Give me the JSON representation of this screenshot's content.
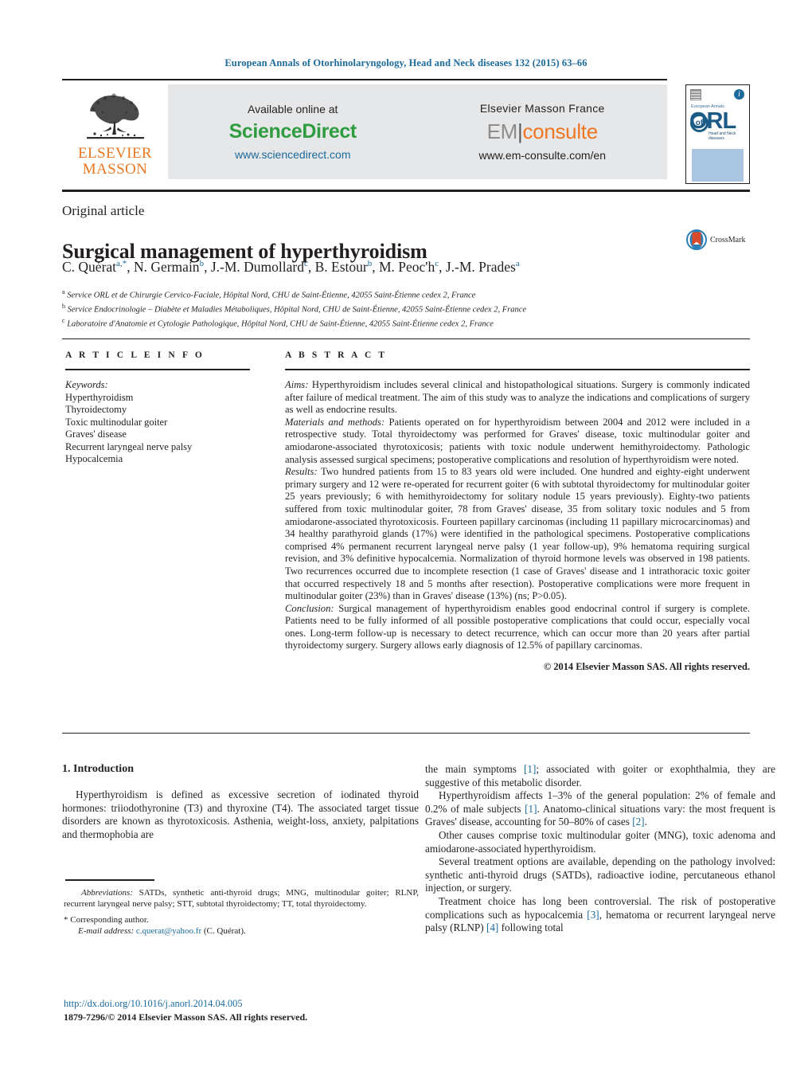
{
  "running_head": "European Annals of Otorhinolaryngology, Head and Neck diseases 132 (2015) 63–66",
  "banner": {
    "publisher_logo_text_line1": "ELSEVIER",
    "publisher_logo_text_line2": "MASSON",
    "sciencedirect": {
      "available_label": "Available online at",
      "brand": "ScienceDirect",
      "url": "www.sciencedirect.com"
    },
    "emconsulte": {
      "publisher_label": "Elsevier Masson France",
      "brand_left": "EM",
      "brand_right": "consulte",
      "url": "www.em-consulte.com/en"
    },
    "cover": {
      "journal_prefix": "European Annals",
      "of": "of",
      "title": "ORL",
      "subtitle": "Head and Neck diseases"
    }
  },
  "article": {
    "kicker": "Original article",
    "title": "Surgical management of hyperthyroidism",
    "crossmark_label": "CrossMark",
    "authors": [
      {
        "name": "C. Quérat",
        "sup": "a,*"
      },
      {
        "name": "N. Germain",
        "sup": "b"
      },
      {
        "name": "J.-M. Dumollard",
        "sup": "c"
      },
      {
        "name": "B. Estour",
        "sup": "b"
      },
      {
        "name": "M. Peoc'h",
        "sup": "c"
      },
      {
        "name": "J.-M. Prades",
        "sup": "a"
      }
    ],
    "affiliations": [
      {
        "mark": "a",
        "text": "Service ORL et de Chirurgie Cervico-Faciale, Hôpital Nord, CHU de Saint-Étienne, 42055 Saint-Étienne cedex 2, France"
      },
      {
        "mark": "b",
        "text": "Service Endocrinologie – Diabète et Maladies Métaboliques, Hôpital Nord, CHU de Saint-Étienne, 42055 Saint-Étienne cedex 2, France"
      },
      {
        "mark": "c",
        "text": "Laboratoire d'Anatomie et Cytologie Pathologique, Hôpital Nord, CHU de Saint-Étienne, 42055 Saint-Étienne cedex 2, France"
      }
    ]
  },
  "article_info": {
    "heading": "A R T I C L E   I N F O",
    "keywords_label": "Keywords:",
    "keywords": [
      "Hyperthyroidism",
      "Thyroidectomy",
      "Toxic multinodular goiter",
      "Graves' disease",
      "Recurrent laryngeal nerve palsy",
      "Hypocalcemia"
    ]
  },
  "abstract": {
    "heading": "A B S T R A C T",
    "aims_label": "Aims:",
    "aims_text": " Hyperthyroidism includes several clinical and histopathological situations. Surgery is commonly indicated after failure of medical treatment. The aim of this study was to analyze the indications and complications of surgery as well as endocrine results.",
    "methods_label": "Materials and methods:",
    "methods_text": " Patients operated on for hyperthyroidism between 2004 and 2012 were included in a retrospective study. Total thyroidectomy was performed for Graves' disease, toxic multinodular goiter and amiodarone-associated thyrotoxicosis; patients with toxic nodule underwent hemithyroidectomy. Pathologic analysis assessed surgical specimens; postoperative complications and resolution of hyperthyroidism were noted.",
    "results_label": "Results:",
    "results_text": " Two hundred patients from 15 to 83 years old were included. One hundred and eighty-eight underwent primary surgery and 12 were re-operated for recurrent goiter (6 with subtotal thyroidectomy for multinodular goiter 25 years previously; 6 with hemithyroidectomy for solitary nodule 15 years previously). Eighty-two patients suffered from toxic multinodular goiter, 78 from Graves' disease, 35 from solitary toxic nodules and 5 from amiodarone-associated thyrotoxicosis. Fourteen papillary carcinomas (including 11 papillary microcarcinomas) and 34 healthy parathyroid glands (17%) were identified in the pathological specimens. Postoperative complications comprised 4% permanent recurrent laryngeal nerve palsy (1 year follow-up), 9% hematoma requiring surgical revision, and 3% definitive hypocalcemia. Normalization of thyroid hormone levels was observed in 198 patients. Two recurrences occurred due to incomplete resection (1 case of Graves' disease and 1 intrathoracic toxic goiter that occurred respectively 18 and 5 months after resection). Postoperative complications were more frequent in multinodular goiter (23%) than in Graves' disease (13%) (ns; P>0.05).",
    "conclusion_label": "Conclusion:",
    "conclusion_text": " Surgical management of hyperthyroidism enables good endocrinal control if surgery is complete. Patients need to be fully informed of all possible postoperative complications that could occur, especially vocal ones. Long-term follow-up is necessary to detect recurrence, which can occur more than 20 years after partial thyroidectomy surgery. Surgery allows early diagnosis of 12.5% of papillary carcinomas.",
    "copyright": "© 2014 Elsevier Masson SAS. All rights reserved."
  },
  "body": {
    "section_heading": "1.  Introduction",
    "left_paragraphs": [
      "Hyperthyroidism is defined as excessive secretion of iodinated thyroid hormones: triiodothyronine (T3) and thyroxine (T4). The associated target tissue disorders are known as thyrotoxicosis. Asthenia, weight-loss, anxiety, palpitations and thermophobia are"
    ],
    "right_paragraph_continuation_pre": "the main symptoms ",
    "right_paragraph_continuation_ref": "[1]",
    "right_paragraph_continuation_post": "; associated with goiter or exophthalmia, they are suggestive of this metabolic disorder.",
    "right_paragraphs": [
      {
        "parts": [
          {
            "t": "Hyperthyroidism affects 1–3% of the general population: 2% of female and 0.2% of male subjects "
          },
          {
            "ref": "[1]"
          },
          {
            "t": ". Anatomo-clinical situations vary: the most frequent is Graves' disease, accounting for 50–80% of cases "
          },
          {
            "ref": "[2]"
          },
          {
            "t": "."
          }
        ]
      },
      {
        "parts": [
          {
            "t": "Other causes comprise toxic multinodular goiter (MNG), toxic adenoma and amiodarone-associated hyperthyroidism."
          }
        ]
      },
      {
        "parts": [
          {
            "t": "Several treatment options are available, depending on the pathology involved: synthetic anti-thyroid drugs (SATDs), radioactive iodine, percutaneous ethanol injection, or surgery."
          }
        ]
      },
      {
        "parts": [
          {
            "t": "Treatment choice has long been controversial. The risk of postoperative complications such as hypocalcemia "
          },
          {
            "ref": "[3]"
          },
          {
            "t": ", hematoma or recurrent laryngeal nerve palsy (RLNP) "
          },
          {
            "ref": "[4]"
          },
          {
            "t": " following total"
          }
        ]
      }
    ]
  },
  "footnotes": {
    "abbrev_label": "Abbreviations:",
    "abbrev_text": "  SATDs, synthetic anti-thyroid drugs; MNG, multinodular goiter; RLNP, recurrent laryngeal nerve palsy; STT, subtotal thyroidectomy; TT, total thyroidectomy.",
    "corresponding": "* Corresponding author.",
    "email_label": "E-mail address:",
    "email": "c.querat@yahoo.fr",
    "email_owner": "(C. Quérat).",
    "doi": "http://dx.doi.org/10.1016/j.anorl.2014.04.005",
    "issn_line": "1879-7296/© 2014 Elsevier Masson SAS. All rights reserved."
  },
  "colors": {
    "link": "#1b6a9c",
    "sciencedirect_green": "#2e9c3f",
    "elsevier_orange": "#e87722",
    "emconsulte_orange": "#ef7622",
    "cover_blue": "#1b5b86",
    "cover_strip": "#a9c5e0"
  }
}
